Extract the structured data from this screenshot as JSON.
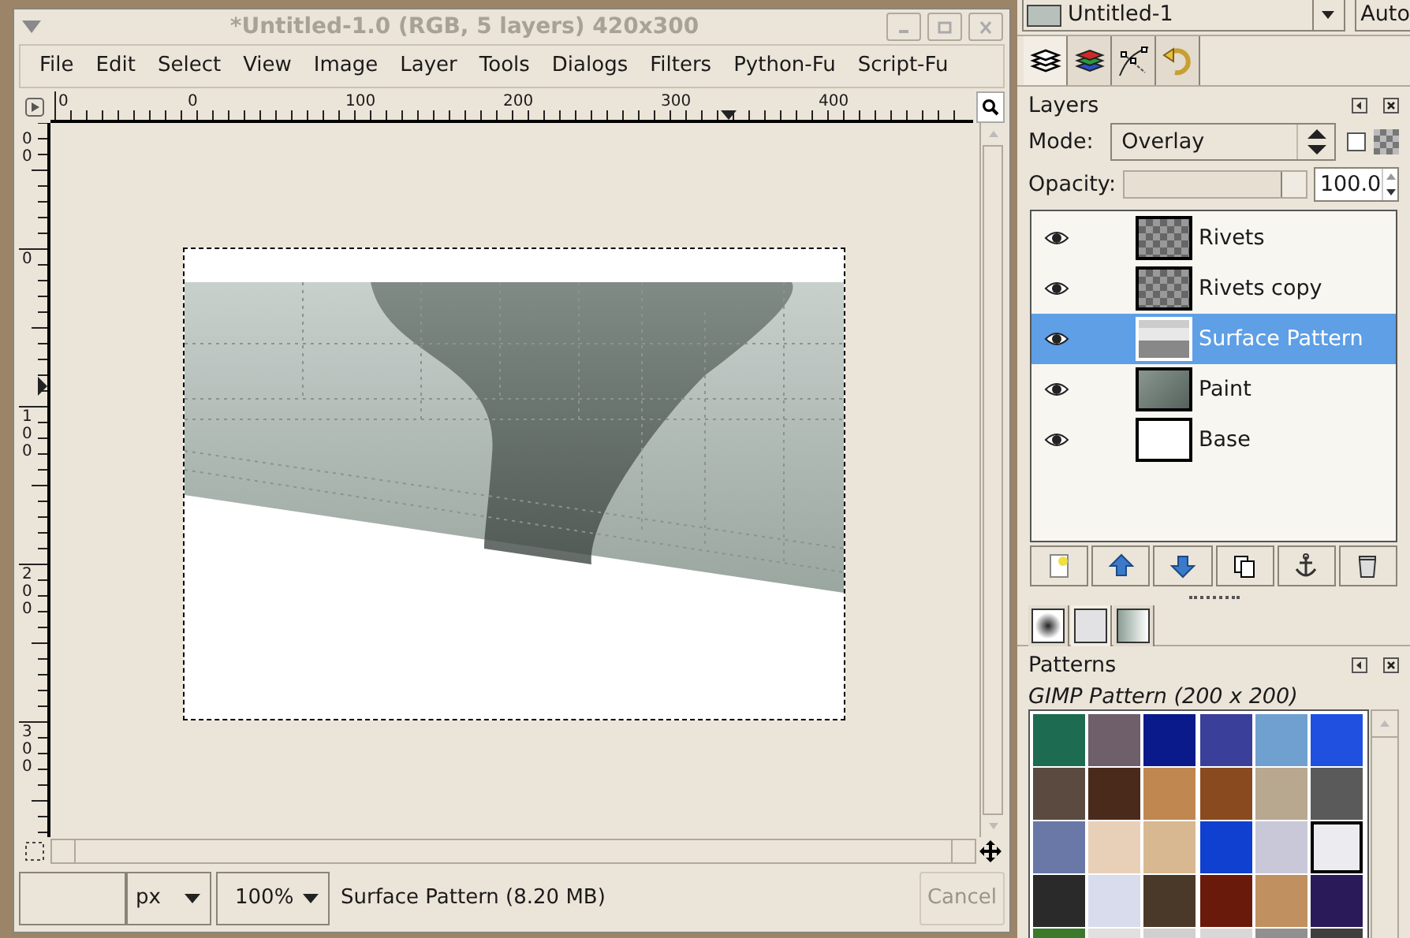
{
  "image_window": {
    "title": "*Untitled-1.0 (RGB, 5 layers) 420x300",
    "menu": [
      {
        "label": "File"
      },
      {
        "label": "Edit"
      },
      {
        "label": "Select"
      },
      {
        "label": "View"
      },
      {
        "label": "Image"
      },
      {
        "label": "Layer"
      },
      {
        "label": "Tools"
      },
      {
        "label": "Dialogs"
      },
      {
        "label": "Filters"
      },
      {
        "label": "Python-Fu"
      },
      {
        "label": "Script-Fu"
      }
    ],
    "h_ruler_labels": [
      "0",
      "0",
      "100",
      "200",
      "300",
      "400"
    ],
    "v_ruler_labels": [
      "00",
      "0",
      "100",
      "200",
      "300"
    ],
    "status": {
      "unit": "px",
      "zoom": "100%",
      "message": "Surface Pattern (8.20 MB)",
      "cancel": {
        "label": "Cancel",
        "disabled": true
      }
    }
  },
  "dock": {
    "image_menu": {
      "label": "Untitled-1"
    },
    "auto_button": "Auto",
    "tabs": [
      {
        "kind": "layers",
        "selected": true
      },
      {
        "kind": "channels",
        "selected": false
      },
      {
        "kind": "paths",
        "selected": false
      },
      {
        "kind": "undo",
        "selected": false
      }
    ],
    "layers": {
      "title": "Layers",
      "mode_label": "Mode:",
      "mode": "Overlay",
      "keep_transparency": false,
      "opacity_label": "Opacity:",
      "opacity": {
        "level": 1,
        "value": "100.0"
      },
      "items": [
        {
          "name": "Rivets",
          "visible": true,
          "kind": "checker",
          "selected": false
        },
        {
          "name": "Rivets copy",
          "visible": true,
          "kind": "checker",
          "selected": false
        },
        {
          "name": "Surface Pattern",
          "visible": true,
          "kind": "surface",
          "selected": true
        },
        {
          "name": "Paint",
          "visible": true,
          "kind": "paint",
          "selected": false
        },
        {
          "name": "Base",
          "visible": true,
          "kind": "white",
          "selected": false
        }
      ]
    },
    "resource_tabs": [
      {
        "kind": "brush",
        "selected": false
      },
      {
        "kind": "pattern",
        "selected": true
      },
      {
        "kind": "gradient",
        "selected": false
      }
    ],
    "patterns": {
      "title": "Patterns",
      "caption": "GIMP Pattern (200 x 200)",
      "swatches": [
        {
          "color": "#1d6b50",
          "selected": false
        },
        {
          "color": "#6e5f6b",
          "selected": false
        },
        {
          "color": "#0a1a8a",
          "selected": false
        },
        {
          "color": "#3a3f9a",
          "selected": false
        },
        {
          "color": "#6fa0d0",
          "selected": false
        },
        {
          "color": "#2050e0",
          "selected": false
        },
        {
          "color": "#5a4a40",
          "selected": false
        },
        {
          "color": "#4a2a1a",
          "selected": false
        },
        {
          "color": "#c08850",
          "selected": false
        },
        {
          "color": "#8a4a20",
          "selected": false
        },
        {
          "color": "#b8a890",
          "selected": false
        },
        {
          "color": "#5a5a5a",
          "selected": false
        },
        {
          "color": "#6a78a8",
          "selected": false
        },
        {
          "color": "#e8d0b8",
          "selected": false
        },
        {
          "color": "#d8b890",
          "selected": false
        },
        {
          "color": "#1040d0",
          "selected": false
        },
        {
          "color": "#c8c8d8",
          "selected": false
        },
        {
          "color": "#ececf0",
          "selected": true
        },
        {
          "color": "#2a2a2a",
          "selected": false
        },
        {
          "color": "#d8dcec",
          "selected": false
        },
        {
          "color": "#4a3828",
          "selected": false
        },
        {
          "color": "#6a1a0a",
          "selected": false
        },
        {
          "color": "#c09060",
          "selected": false
        },
        {
          "color": "#2a1a5a",
          "selected": false
        },
        {
          "color": "#3a7a2a",
          "selected": false
        },
        {
          "color": "#e0e0e0",
          "selected": false
        },
        {
          "color": "#d0d0d0",
          "selected": false
        },
        {
          "color": "#d8d8d8",
          "selected": false
        },
        {
          "color": "#909090",
          "selected": false
        },
        {
          "color": "#404040",
          "selected": false
        }
      ]
    }
  }
}
